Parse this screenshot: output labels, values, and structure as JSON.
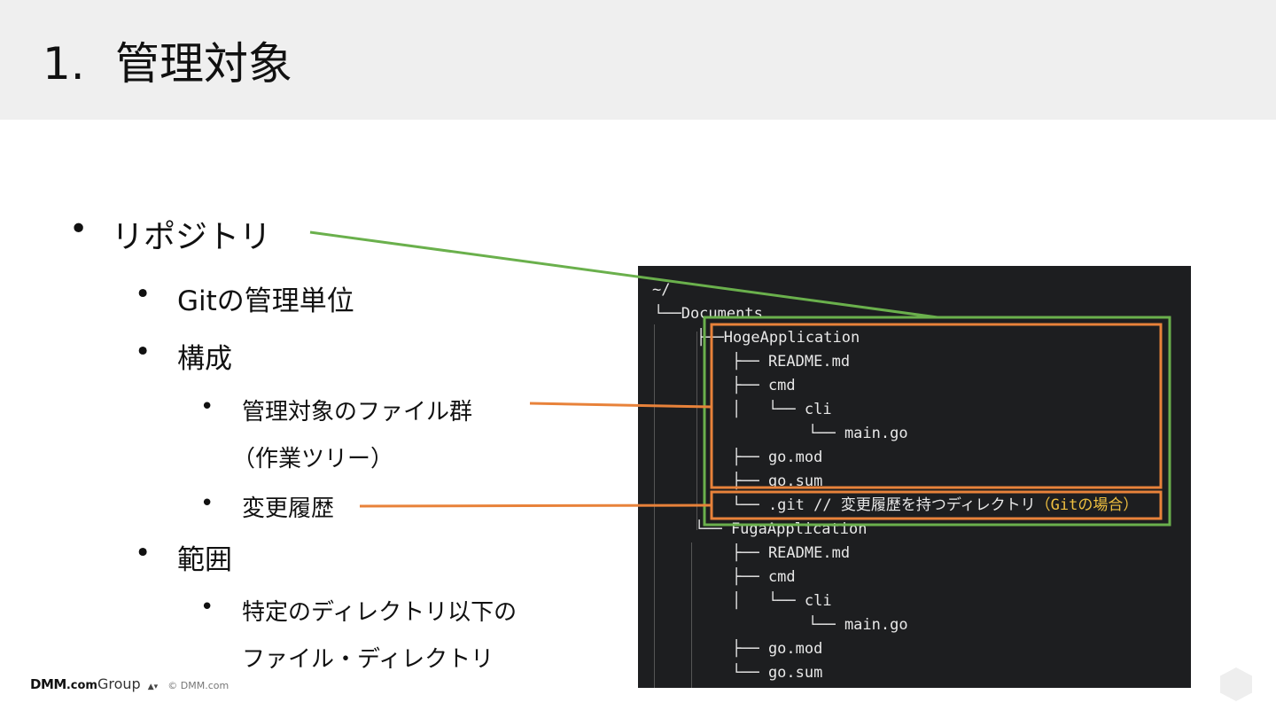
{
  "slide": {
    "number": "1.",
    "title": "管理対象"
  },
  "bullets": {
    "repository": "リポジトリ",
    "git_unit": "Gitの管理単位",
    "structure": "構成",
    "managed_files": "管理対象のファイル群",
    "working_tree": "（作業ツリー）",
    "history": "変更履歴",
    "scope": "範囲",
    "scope_detail_1": "特定のディレクトリ以下の",
    "scope_detail_2": "ファイル・ディレクトリ",
    "dot": "•"
  },
  "terminal": {
    "lines": [
      "~/",
      "└──Documents",
      "├──HogeApplication",
      "├── README.md",
      "├── cmd",
      "│   └── cli",
      "└── main.go",
      "├── go.mod",
      "├── go.sum",
      "└── .git // 変更履歴を持つディレクトリ",
      "（Gitの場合）",
      "└── FugaApplication",
      "├── README.md",
      "├── cmd",
      "│   └── cli",
      "└── main.go",
      "├── go.mod",
      "└── go.sum"
    ]
  },
  "footer": {
    "logo": "DMM",
    "logo_com": ".com",
    "logo_group": "Group",
    "copyright": "© DMM.com"
  },
  "colors": {
    "green": "#6ab04c",
    "orange": "#e8823a",
    "terminal_bg": "#1d1e20",
    "accent_yellow": "#f0c040"
  }
}
